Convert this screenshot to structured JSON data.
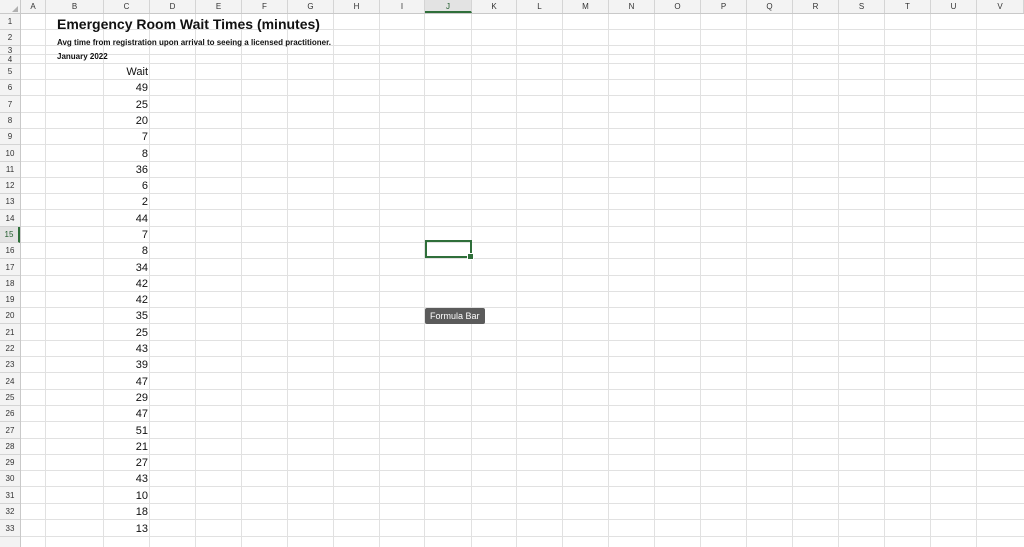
{
  "sheet": {
    "columns": [
      "A",
      "B",
      "C",
      "D",
      "E",
      "F",
      "G",
      "H",
      "I",
      "J",
      "K",
      "L",
      "M",
      "N",
      "O",
      "P",
      "Q",
      "R",
      "S",
      "T",
      "U",
      "V"
    ],
    "active_column": "J",
    "rows": [
      "1",
      "2",
      "3",
      "4",
      "5",
      "6",
      "7",
      "8",
      "9",
      "10",
      "11",
      "12",
      "13",
      "14",
      "15",
      "16",
      "17",
      "18",
      "19",
      "20",
      "21",
      "22",
      "23",
      "24",
      "25",
      "26",
      "27",
      "28",
      "29",
      "30",
      "31",
      "32",
      "33"
    ],
    "active_row": "15"
  },
  "content": {
    "title": "Emergency Room Wait Times (minutes)",
    "subtitle": "Avg time from registration upon arrival to seeing a licensed practitioner.",
    "date": "January 2022",
    "wait_header": "Wait",
    "wait_values": [
      "49",
      "25",
      "20",
      "7",
      "8",
      "36",
      "6",
      "2",
      "44",
      "7",
      "8",
      "34",
      "42",
      "42",
      "35",
      "25",
      "43",
      "39",
      "47",
      "29",
      "47",
      "51",
      "21",
      "27",
      "43",
      "10",
      "18",
      "13"
    ]
  },
  "tooltip": {
    "label": "Formula Bar"
  },
  "colors": {
    "selection": "#2f6f3a",
    "header_bg": "#f3f3f3",
    "gridline": "#e1e1e1",
    "tooltip_bg": "#5b5b5b"
  }
}
